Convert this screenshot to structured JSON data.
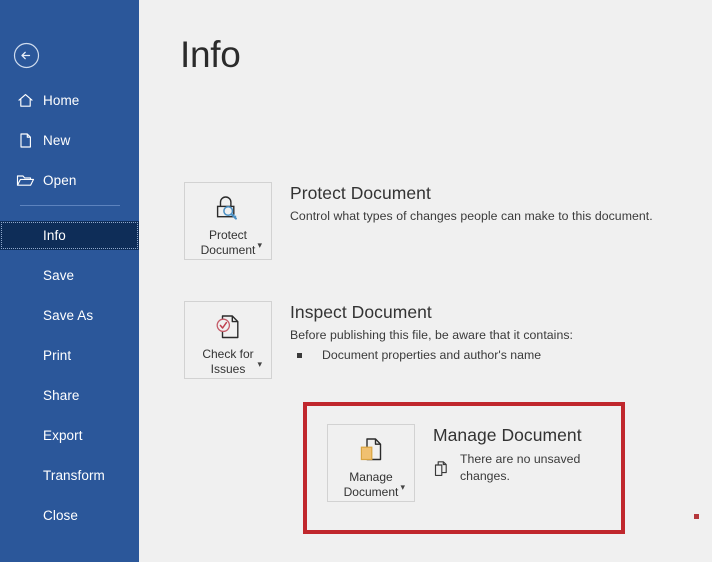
{
  "window": {
    "accent_blue": "#2b579a",
    "active_blue": "#0e2d58",
    "highlight_red": "#c0272d",
    "background": "#f0f0f0"
  },
  "sidebar": {
    "back_label": "Back",
    "items": [
      {
        "label": "Home",
        "icon": "home-icon",
        "active": false
      },
      {
        "label": "New",
        "icon": "page-icon",
        "active": false
      },
      {
        "label": "Open",
        "icon": "folder-icon",
        "active": false
      },
      {
        "label": "Info",
        "icon": "",
        "active": true
      },
      {
        "label": "Save",
        "icon": "",
        "active": false
      },
      {
        "label": "Save As",
        "icon": "",
        "active": false
      },
      {
        "label": "Print",
        "icon": "",
        "active": false
      },
      {
        "label": "Share",
        "icon": "",
        "active": false
      },
      {
        "label": "Export",
        "icon": "",
        "active": false
      },
      {
        "label": "Transform",
        "icon": "",
        "active": false
      },
      {
        "label": "Close",
        "icon": "",
        "active": false
      }
    ]
  },
  "main": {
    "title": "Info",
    "sections": {
      "protect": {
        "button_label": "Protect\nDocument",
        "button_icon": "lock-magnifier-icon",
        "title": "Protect Document",
        "description": "Control what types of changes people can make to this document."
      },
      "inspect": {
        "button_label": "Check for\nIssues",
        "button_icon": "document-check-icon",
        "title": "Inspect Document",
        "description": "Before publishing this file, be aware that it contains:",
        "bullets": [
          "Document properties and author's name"
        ]
      },
      "manage": {
        "button_label": "Manage\nDocument",
        "button_icon": "document-versions-icon",
        "title": "Manage Document",
        "status_icon": "copy-documents-icon",
        "status": "There are no unsaved changes.",
        "highlighted": true
      }
    }
  },
  "annotations": {
    "red_marker": "red-square-marker"
  }
}
